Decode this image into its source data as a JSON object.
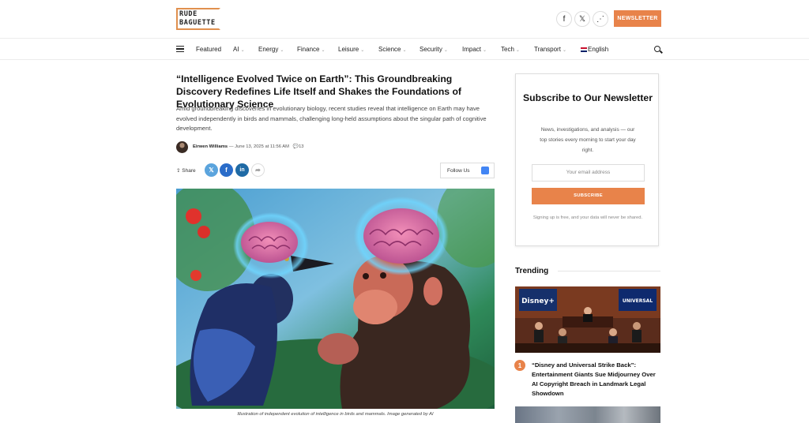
{
  "header": {
    "logo_line1": "RUDE",
    "logo_line2": "BAGUETTE",
    "social": [
      {
        "icon": "facebook-icon",
        "glyph": "f"
      },
      {
        "icon": "x-icon",
        "glyph": "𝕏"
      },
      {
        "icon": "rss-icon",
        "glyph": "⋰"
      }
    ],
    "newsletter_label": "NEWSLETTER"
  },
  "nav": {
    "items": [
      {
        "label": "Featured",
        "dropdown": false
      },
      {
        "label": "AI",
        "dropdown": true
      },
      {
        "label": "Energy",
        "dropdown": true
      },
      {
        "label": "Finance",
        "dropdown": true
      },
      {
        "label": "Leisure",
        "dropdown": true
      },
      {
        "label": "Science",
        "dropdown": true
      },
      {
        "label": "Security",
        "dropdown": true
      },
      {
        "label": "Impact",
        "dropdown": true
      },
      {
        "label": "Tech",
        "dropdown": true
      },
      {
        "label": "Transport",
        "dropdown": true
      }
    ],
    "language": "English"
  },
  "article": {
    "title": "“Intelligence Evolved Twice on Earth”: This Groundbreaking Discovery Redefines Life Itself and Shakes the Foundations of Evolutionary Science",
    "excerpt": "Amid groundbreaking discoveries in evolutionary biology, recent studies reveal that intelligence on Earth may have evolved independently in birds and mammals, challenging long-held assumptions about the singular path of cognitive development.",
    "author": "Eirwen Williams",
    "date": "— June 13, 2025 at 11:56 AM",
    "comments": "13",
    "share_label": "Share",
    "follow_label": "Follow Us",
    "caption": "Illustration of independent evolution of intelligence in birds and mammals. Image generated by AI"
  },
  "sidebar": {
    "subscribe_title": "Subscribe to Our Newsletter",
    "subscribe_desc": "News, investigations, and analysis — our top stories every morning to start your day right.",
    "email_placeholder": "Your email address",
    "subscribe_button": "SUBSCRIBE",
    "subscribe_note": "Signing up is free, and your data will never be shared.",
    "trending_title": "Trending",
    "trending": [
      {
        "rank": "1",
        "title": "“Disney and Universal Strike Back”: Entertainment Giants Sue Midjourney Over AI Copyright Breach in Landmark Legal Showdown"
      }
    ],
    "trend_image_text": {
      "disney": "Disney+",
      "universal": "UNIVERSAL"
    }
  },
  "colors": {
    "accent": "#e8834a"
  }
}
